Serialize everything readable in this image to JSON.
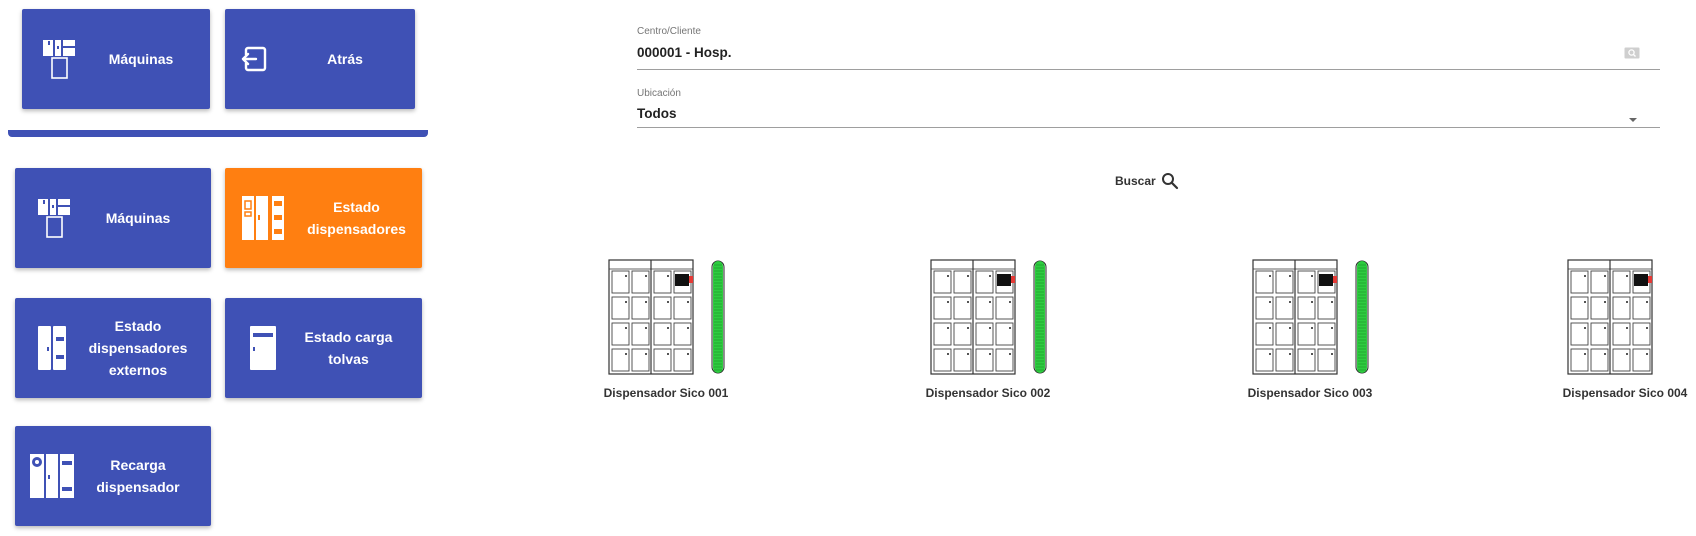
{
  "nav_top": {
    "machines_label": "Máquinas",
    "back_label": "Atrás"
  },
  "menu": {
    "machines_label": "Máquinas",
    "dispenser_status_label": "Estado dispensadores",
    "external_dispenser_status_label": "Estado dispensadores externos",
    "hopper_load_status_label": "Estado carga tolvas",
    "dispenser_refill_label": "Recarga dispensador"
  },
  "filters": {
    "center": {
      "label": "Centro/Cliente",
      "value": "000001 - Hosp."
    },
    "location": {
      "label": "Ubicación",
      "value": "Todos"
    }
  },
  "search": {
    "label": "Buscar"
  },
  "machines": [
    {
      "name": "Dispensador Sico 001",
      "status_level": 1.0,
      "has_status_bar": true
    },
    {
      "name": "Dispensador Sico 002",
      "status_level": 1.0,
      "has_status_bar": true
    },
    {
      "name": "Dispensador Sico 003",
      "status_level": 1.0,
      "has_status_bar": true
    },
    {
      "name": "Dispensador Sico 004",
      "status_level": null,
      "has_status_bar": false
    }
  ],
  "colors": {
    "primary": "#3f51b5",
    "accent_active": "#ff7f11",
    "status_ok": "#2ecc40",
    "alert_red": "#e53935"
  },
  "icons": {
    "machines": "machine-icon",
    "back": "exit-icon",
    "dispenser_status": "dispenser-status-icon",
    "external_dispensers": "external-dispenser-icon",
    "hoppers": "hopper-icon",
    "refill": "refill-dispenser-icon",
    "search": "search-icon",
    "dropdown": "chevron-down-icon",
    "field_search": "search-box-icon"
  }
}
